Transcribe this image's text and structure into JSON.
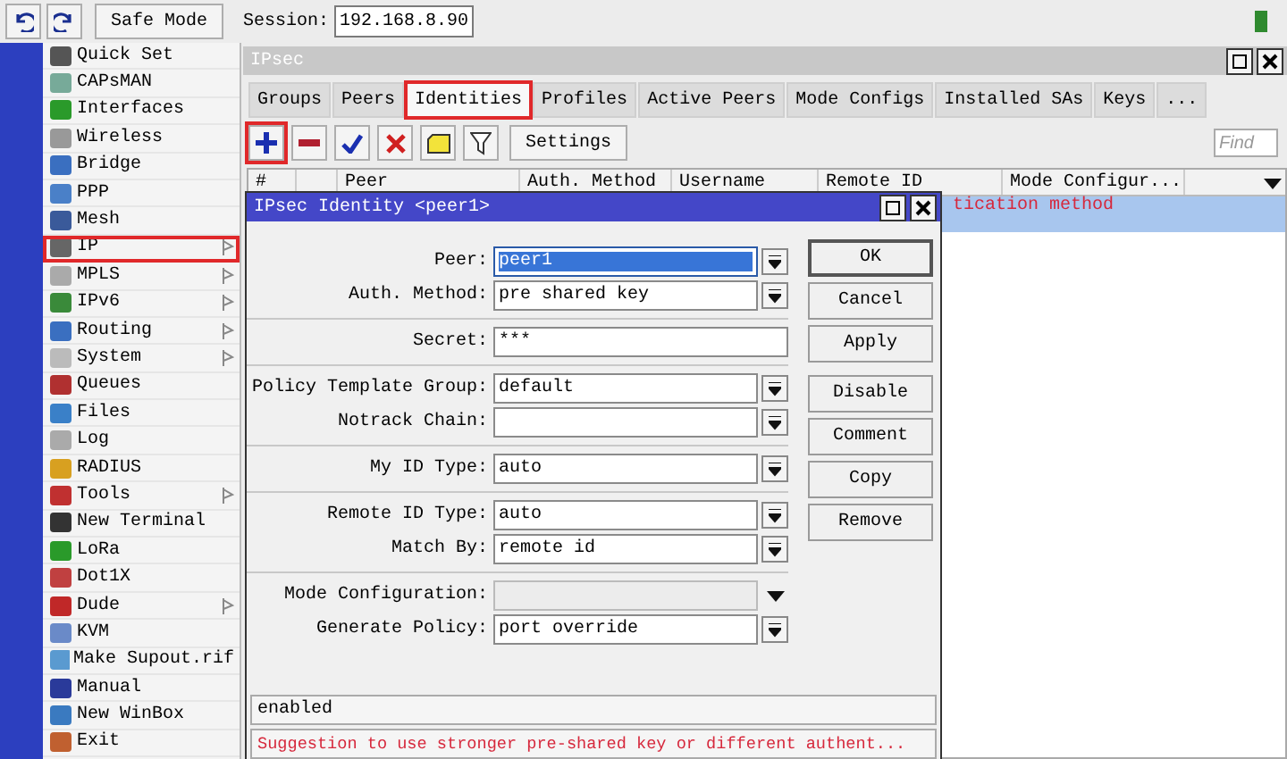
{
  "toolbar": {
    "safe_mode": "Safe Mode",
    "session_label": "Session:",
    "session_value": "192.168.8.90"
  },
  "menu": [
    {
      "label": "Quick Set",
      "submenu": false,
      "highlighted": false
    },
    {
      "label": "CAPsMAN",
      "submenu": false,
      "highlighted": false
    },
    {
      "label": "Interfaces",
      "submenu": false,
      "highlighted": false
    },
    {
      "label": "Wireless",
      "submenu": false,
      "highlighted": false
    },
    {
      "label": "Bridge",
      "submenu": false,
      "highlighted": false
    },
    {
      "label": "PPP",
      "submenu": false,
      "highlighted": false
    },
    {
      "label": "Mesh",
      "submenu": false,
      "highlighted": false
    },
    {
      "label": "IP",
      "submenu": true,
      "highlighted": true
    },
    {
      "label": "MPLS",
      "submenu": true,
      "highlighted": false
    },
    {
      "label": "IPv6",
      "submenu": true,
      "highlighted": false
    },
    {
      "label": "Routing",
      "submenu": true,
      "highlighted": false
    },
    {
      "label": "System",
      "submenu": true,
      "highlighted": false
    },
    {
      "label": "Queues",
      "submenu": false,
      "highlighted": false
    },
    {
      "label": "Files",
      "submenu": false,
      "highlighted": false
    },
    {
      "label": "Log",
      "submenu": false,
      "highlighted": false
    },
    {
      "label": "RADIUS",
      "submenu": false,
      "highlighted": false
    },
    {
      "label": "Tools",
      "submenu": true,
      "highlighted": false
    },
    {
      "label": "New Terminal",
      "submenu": false,
      "highlighted": false
    },
    {
      "label": "LoRa",
      "submenu": false,
      "highlighted": false
    },
    {
      "label": "Dot1X",
      "submenu": false,
      "highlighted": false
    },
    {
      "label": "Dude",
      "submenu": true,
      "highlighted": false
    },
    {
      "label": "KVM",
      "submenu": false,
      "highlighted": false
    },
    {
      "label": "Make Supout.rif",
      "submenu": false,
      "highlighted": false
    },
    {
      "label": "Manual",
      "submenu": false,
      "highlighted": false
    },
    {
      "label": "New WinBox",
      "submenu": false,
      "highlighted": false
    },
    {
      "label": "Exit",
      "submenu": false,
      "highlighted": false
    }
  ],
  "window": {
    "title": "IPsec"
  },
  "tabs": [
    {
      "label": "Groups",
      "selected": false,
      "highlighted": false
    },
    {
      "label": "Peers",
      "selected": false,
      "highlighted": false
    },
    {
      "label": "Identities",
      "selected": true,
      "highlighted": true
    },
    {
      "label": "Profiles",
      "selected": false,
      "highlighted": false
    },
    {
      "label": "Active Peers",
      "selected": false,
      "highlighted": false
    },
    {
      "label": "Mode Configs",
      "selected": false,
      "highlighted": false
    },
    {
      "label": "Installed SAs",
      "selected": false,
      "highlighted": false
    },
    {
      "label": "Keys",
      "selected": false,
      "highlighted": false
    },
    {
      "label": "...",
      "selected": false,
      "highlighted": false
    }
  ],
  "tools": [
    {
      "kind": "add",
      "highlighted": true
    },
    {
      "kind": "remove",
      "highlighted": false
    },
    {
      "kind": "enable",
      "highlighted": false
    },
    {
      "kind": "disable",
      "highlighted": false
    },
    {
      "kind": "comment",
      "highlighted": false
    },
    {
      "kind": "filter",
      "highlighted": false
    }
  ],
  "settings_button": "Settings",
  "find": {
    "placeholder": "Find"
  },
  "table": {
    "columns": [
      "#",
      "Peer",
      "Auth. Method",
      "Username",
      "Remote ID",
      "Mode Configur..."
    ],
    "rows": [
      {
        "comment": "tication method",
        "selected": true
      }
    ]
  },
  "dialog": {
    "title": "IPsec Identity <peer1>",
    "groups": [
      [
        {
          "label": "Peer:",
          "value": "peer1",
          "kind": "select",
          "selected": true,
          "disabled": false
        },
        {
          "label": "Auth. Method:",
          "value": "pre shared key",
          "kind": "select",
          "selected": false,
          "disabled": false
        }
      ],
      [
        {
          "label": "Secret:",
          "value": "***",
          "kind": "text",
          "selected": false,
          "disabled": false
        }
      ],
      [
        {
          "label": "Policy Template Group:",
          "value": "default",
          "kind": "select",
          "selected": false,
          "disabled": false
        },
        {
          "label": "Notrack Chain:",
          "kind": "select",
          "selected": false,
          "disabled": false
        }
      ],
      [
        {
          "label": "My ID Type:",
          "value": "auto",
          "kind": "select",
          "selected": false,
          "disabled": false
        }
      ],
      [
        {
          "label": "Remote ID Type:",
          "value": "auto",
          "kind": "select",
          "selected": false,
          "disabled": false
        },
        {
          "label": "Match By:",
          "value": "remote id",
          "kind": "select",
          "selected": false,
          "disabled": false
        }
      ],
      [
        {
          "label": "Mode Configuration:",
          "kind": "select",
          "selected": false,
          "disabled": true
        },
        {
          "label": "Generate Policy:",
          "value": "port override",
          "kind": "select",
          "selected": false,
          "disabled": false
        }
      ]
    ],
    "buttons": [
      {
        "label": "OK",
        "default": true
      },
      {
        "label": "Cancel",
        "default": false
      },
      {
        "label": "Apply",
        "default": false
      },
      {
        "label": "Disable",
        "default": false
      },
      {
        "label": "Comment",
        "default": false
      },
      {
        "label": "Copy",
        "default": false
      },
      {
        "label": "Remove",
        "default": false
      }
    ],
    "status": "enabled",
    "message": "Suggestion to use stronger pre-shared key or different authent..."
  }
}
